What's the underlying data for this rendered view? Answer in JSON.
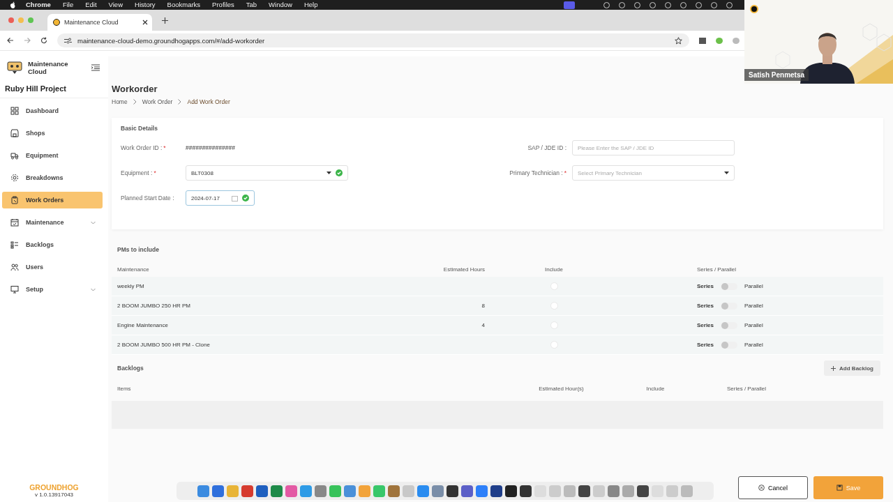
{
  "menubar": {
    "app": "Chrome",
    "menus": [
      "File",
      "Edit",
      "View",
      "History",
      "Bookmarks",
      "Profiles",
      "Tab",
      "Window",
      "Help"
    ]
  },
  "browser": {
    "tab_title": "Maintenance Cloud",
    "url": "maintenance-cloud-demo.groundhogapps.com/#/add-workorder"
  },
  "video": {
    "name": "Satish Penmetsa"
  },
  "sidebar": {
    "logo_text": "Maintenance Cloud",
    "project": "Ruby Hill Project",
    "items": [
      {
        "label": "Dashboard",
        "selected": false,
        "expandable": false
      },
      {
        "label": "Shops",
        "selected": false,
        "expandable": false
      },
      {
        "label": "Equipment",
        "selected": false,
        "expandable": false
      },
      {
        "label": "Breakdowns",
        "selected": false,
        "expandable": false
      },
      {
        "label": "Work Orders",
        "selected": true,
        "expandable": false
      },
      {
        "label": "Maintenance",
        "selected": false,
        "expandable": true
      },
      {
        "label": "Backlogs",
        "selected": false,
        "expandable": false
      },
      {
        "label": "Users",
        "selected": false,
        "expandable": false
      },
      {
        "label": "Setup",
        "selected": false,
        "expandable": true
      }
    ],
    "brand": "GROUNDHOG",
    "version": "v 1.0.13917043"
  },
  "page": {
    "title": "Workorder",
    "breadcrumbs": [
      "Home",
      "Work Order",
      "Add Work Order"
    ]
  },
  "basic_details": {
    "title": "Basic Details",
    "work_order_id": {
      "label": "Work Order ID :",
      "required_mark": "*",
      "value": "###############"
    },
    "sap_id": {
      "label": "SAP / JDE ID :",
      "placeholder": "Please Enter the SAP / JDE ID"
    },
    "equipment": {
      "label": "Equipment :",
      "required_mark": "*",
      "value": "BLT0308",
      "valid": true
    },
    "primary_technician": {
      "label": "Primary Technician :",
      "required_mark": "*",
      "placeholder": "Select Primary Technician"
    },
    "planned_start_date": {
      "label": "Planned Start Date :",
      "value": "2024-07-17",
      "valid": true
    }
  },
  "pms": {
    "title": "PMs to include",
    "columns": [
      "Maintenance",
      "Estimated Hours",
      "Include",
      "Series / Parallel"
    ],
    "rows": [
      {
        "maintenance": "weekly PM",
        "include": false,
        "series": "Series",
        "parallel": "Parallel",
        "parallel_on": false
      },
      {
        "maintenance": "2 BOOM JUMBO 250 HR PM",
        "hours": "8",
        "include": false,
        "series": "Series",
        "parallel": "Parallel",
        "parallel_on": false
      },
      {
        "maintenance": "Engine Maintenance",
        "hours": "4",
        "include": false,
        "series": "Series",
        "parallel": "Parallel",
        "parallel_on": false
      },
      {
        "maintenance": "2 BOOM JUMBO 500 HR PM - Clone",
        "include": false,
        "series": "Series",
        "parallel": "Parallel",
        "parallel_on": false
      }
    ]
  },
  "backlogs": {
    "title": "Backlogs",
    "add_button": "Add Backlog",
    "columns": [
      "Items",
      "Estimated Hour(s)",
      "Include",
      "Series / Parallel"
    ]
  },
  "footer": {
    "cancel": "Cancel",
    "save": "Save"
  }
}
